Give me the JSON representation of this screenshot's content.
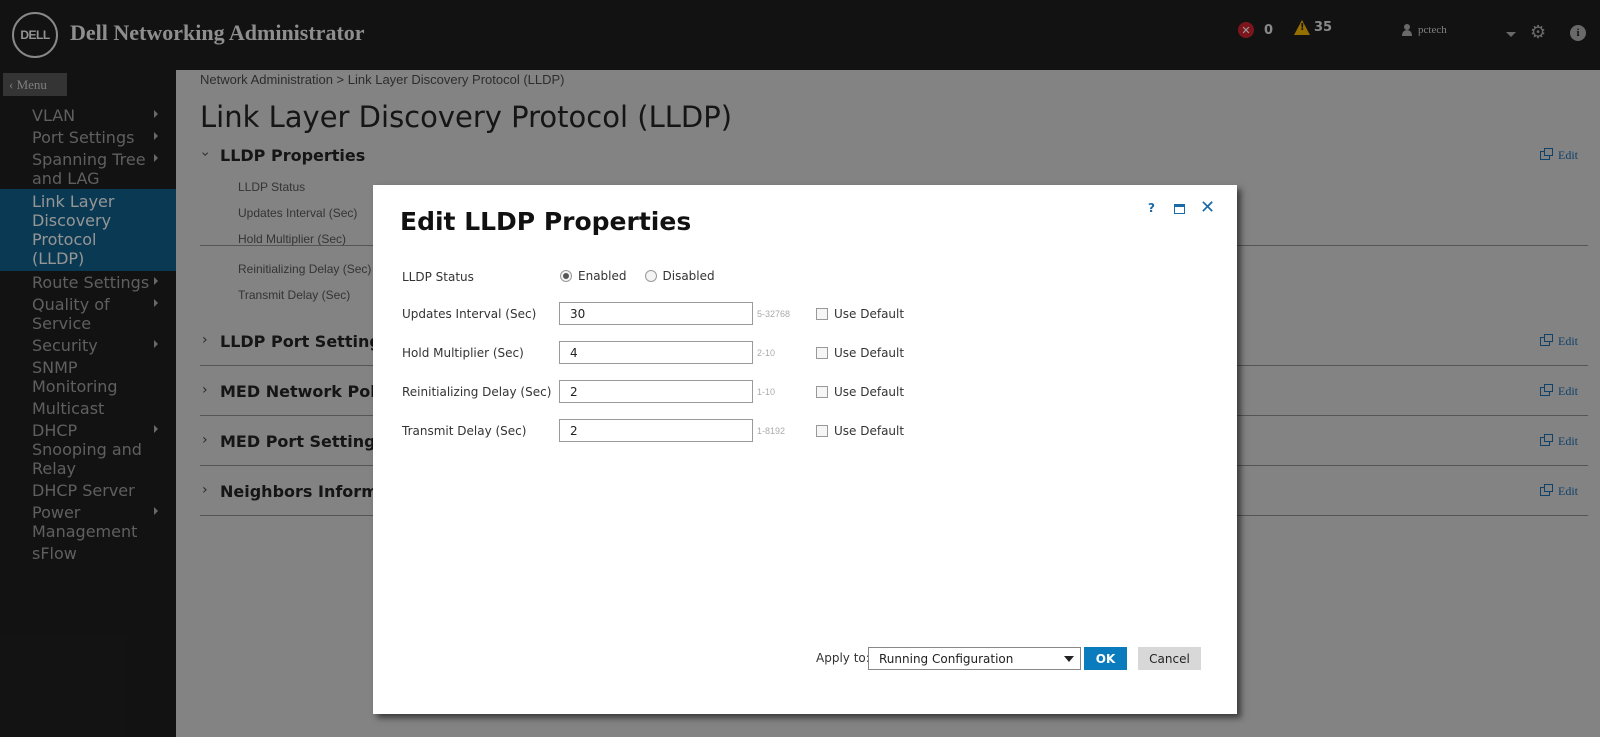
{
  "header": {
    "logo_text": "DELL",
    "title": "Dell Networking Administrator",
    "error_count": "0",
    "warning_count": "35",
    "username": "pctech",
    "icons": [
      "error-icon",
      "warning-icon",
      "user-icon",
      "chevron-down-icon",
      "gear-icon",
      "info-icon"
    ]
  },
  "sidebar": {
    "menu_label": "Menu",
    "items": [
      {
        "label": "VLAN",
        "has_submenu": true,
        "active": false
      },
      {
        "label": "Port Settings",
        "has_submenu": true,
        "active": false
      },
      {
        "label": "Spanning Tree and LAG",
        "has_submenu": true,
        "active": false
      },
      {
        "label": "Link Layer Discovery Protocol (LLDP)",
        "has_submenu": false,
        "active": true
      },
      {
        "label": "Route Settings",
        "has_submenu": true,
        "active": false
      },
      {
        "label": "Quality of Service",
        "has_submenu": true,
        "active": false
      },
      {
        "label": "Security",
        "has_submenu": true,
        "active": false
      },
      {
        "label": "SNMP Monitoring",
        "has_submenu": false,
        "active": false
      },
      {
        "label": "Multicast",
        "has_submenu": false,
        "active": false
      },
      {
        "label": "DHCP Snooping and Relay",
        "has_submenu": true,
        "active": false
      },
      {
        "label": "DHCP Server",
        "has_submenu": false,
        "active": false
      },
      {
        "label": "Power Management",
        "has_submenu": true,
        "active": false
      },
      {
        "label": "sFlow",
        "has_submenu": false,
        "active": false
      }
    ]
  },
  "main": {
    "breadcrumb": "Network Administration > Link Layer Discovery Protocol (LLDP)",
    "page_title": "Link Layer Discovery Protocol (LLDP)",
    "edit_label": "Edit",
    "sections": [
      {
        "title": "LLDP Properties",
        "expanded": true
      },
      {
        "title": "LLDP Port Settings",
        "expanded": false
      },
      {
        "title": "MED Network Policy",
        "expanded": false
      },
      {
        "title": "MED Port Settings",
        "expanded": false
      },
      {
        "title": "Neighbors Informat",
        "expanded": false
      }
    ],
    "properties": [
      "LLDP Status",
      "Updates Interval (Sec)",
      "Hold Multiplier (Sec)",
      "Reinitializing Delay (Sec)",
      "Transmit Delay (Sec)"
    ]
  },
  "dialog": {
    "title": "Edit LLDP Properties",
    "help_label": "?",
    "close_label": "✕",
    "status": {
      "label": "LLDP Status",
      "options": [
        "Enabled",
        "Disabled"
      ],
      "selected": "Enabled"
    },
    "fields": [
      {
        "label": "Updates Interval (Sec)",
        "value": "30",
        "range": "5-32768",
        "use_default_label": "Use Default",
        "use_default": false
      },
      {
        "label": "Hold Multiplier (Sec)",
        "value": "4",
        "range": "2-10",
        "use_default_label": "Use Default",
        "use_default": false
      },
      {
        "label": "Reinitializing Delay (Sec)",
        "value": "2",
        "range": "1-10",
        "use_default_label": "Use Default",
        "use_default": false
      },
      {
        "label": "Transmit Delay (Sec)",
        "value": "2",
        "range": "1-8192",
        "use_default_label": "Use Default",
        "use_default": false
      }
    ],
    "apply_to_label": "Apply to:",
    "apply_to_value": "Running Configuration",
    "ok_label": "OK",
    "cancel_label": "Cancel"
  },
  "colors": {
    "header_bg": "#1e1e1e",
    "active_nav": "#0f5d87",
    "accent_blue": "#0a7bbd",
    "link_blue": "#1b6aa8",
    "error_red": "#c8242e",
    "warning_yellow": "#f0b400"
  }
}
